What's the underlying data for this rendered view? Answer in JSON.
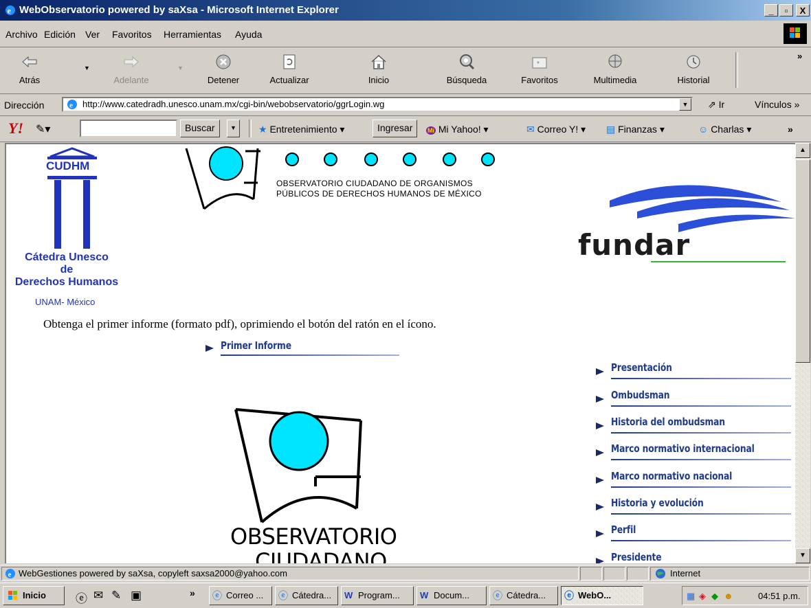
{
  "window": {
    "title": "WebObservatorio powered by saXsa - Microsoft Internet Explorer",
    "btn_min": "_",
    "btn_max": "▫",
    "btn_close": "X"
  },
  "menu": [
    "Archivo",
    "Edición",
    "Ver",
    "Favoritos",
    "Herramientas",
    "Ayuda"
  ],
  "toolbar": {
    "back": "Atrás",
    "forward": "Adelante",
    "stop": "Detener",
    "refresh": "Actualizar",
    "home": "Inicio",
    "search": "Búsqueda",
    "favorites": "Favoritos",
    "media": "Multimedia",
    "history": "Historial",
    "more": "»"
  },
  "address": {
    "label": "Dirección",
    "url": "http://www.catedradh.unesco.unam.mx/cgi-bin/webobservatorio/ggrLogin.wg",
    "go": "Ir",
    "links": "Vínculos »"
  },
  "yahoo": {
    "logo": "Y!",
    "search_btn": "Buscar",
    "entertainment": "Entretenimiento",
    "login_btn": "Ingresar",
    "my_yahoo": "Mi Yahoo!",
    "mail": "Correo Y!",
    "finance": "Finanzas",
    "chat": "Charlas",
    "more": "»"
  },
  "page": {
    "cudhm_label": "CUDHM",
    "catedra_line1": "Cátedra Unesco",
    "catedra_line2": "de",
    "catedra_line3": "Derechos Humanos",
    "catedra_line4": "UNAM- México",
    "observatorio_line1": "OBSERVATORIO CIUDADANO DE ORGANISMOS",
    "observatorio_line2": "PÚBLICOS DE DERECHOS HUMANOS DE MÉXICO",
    "fundar": "fundar",
    "intro": "Obtenga el primer informe (formato pdf), oprimiendo el botón del ratón en el ícono.",
    "primer_informe": "Primer Informe",
    "big_logo_line1": "OBSERVATORIO",
    "big_logo_line2": "CIUDADANO",
    "nav": [
      "Presentación",
      "Ombudsman",
      "Historia del ombudsman",
      "Marco normativo internacional",
      "Marco normativo nacional",
      "Historia y evolución",
      "Perfil",
      "Presidente"
    ]
  },
  "status": {
    "text": "WebGestiones powered by saXsa, copyleft saxsa2000@yahoo.com",
    "zone": "Internet"
  },
  "taskbar": {
    "start": "Inicio",
    "chevron": "»",
    "tasks": [
      "Correo ...",
      "Cátedra...",
      "Program...",
      "Docum...",
      "Cátedra...",
      "WebO..."
    ],
    "clock": "04:51 p.m."
  },
  "colors": {
    "accent_cyan": "#00e5ff",
    "nav_blue": "#1f3a8a",
    "fundar_green": "#2db82d"
  }
}
